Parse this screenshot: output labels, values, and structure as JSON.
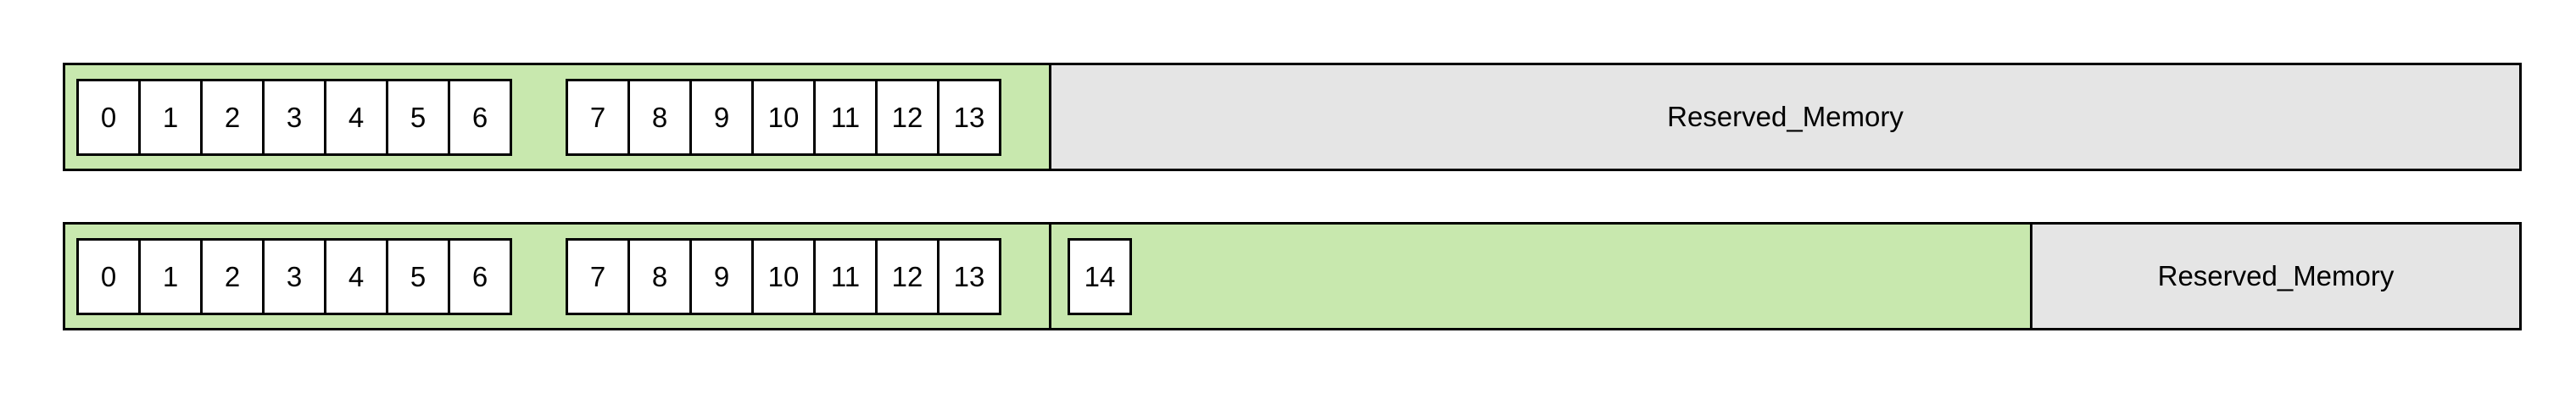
{
  "colors": {
    "used_region": "#c8e8ae",
    "reserved_region": "#e5e5e5",
    "cell_fill": "#ffffff",
    "border": "#000000"
  },
  "row1": {
    "block_a": [
      "0",
      "1",
      "2",
      "3",
      "4",
      "5",
      "6"
    ],
    "block_b": [
      "7",
      "8",
      "9",
      "10",
      "11",
      "12",
      "13"
    ],
    "reserved_label": "Reserved_Memory"
  },
  "row2": {
    "block_a": [
      "0",
      "1",
      "2",
      "3",
      "4",
      "5",
      "6"
    ],
    "block_b": [
      "7",
      "8",
      "9",
      "10",
      "11",
      "12",
      "13"
    ],
    "block_c": [
      "14"
    ],
    "reserved_label": "Reserved_Memory"
  }
}
